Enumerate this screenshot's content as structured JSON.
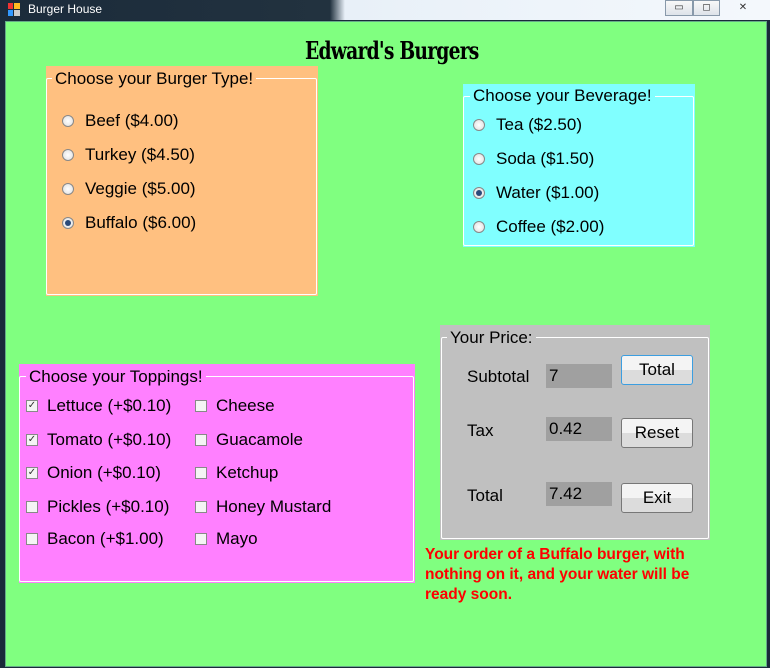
{
  "window": {
    "title": "Burger House",
    "minimize": "▭",
    "restore": "◻",
    "close": "✕"
  },
  "heading": "Edward's Burgers",
  "burger": {
    "legend": "Choose your Burger Type!",
    "options": [
      "Beef ($4.00)",
      "Turkey ($4.50)",
      "Veggie ($5.00)",
      "Buffalo ($6.00)"
    ],
    "selected": 3
  },
  "beverage": {
    "legend": "Choose your Beverage!",
    "options": [
      "Tea ($2.50)",
      "Soda ($1.50)",
      "Water ($1.00)",
      "Coffee ($2.00)"
    ],
    "selected": 2
  },
  "toppings": {
    "legend": "Choose your Toppings!",
    "col1": [
      "Lettuce (+$0.10)",
      "Tomato (+$0.10)",
      "Onion (+$0.10)",
      "Pickles (+$0.10)",
      "Bacon (+$1.00)"
    ],
    "col1_checked": [
      true,
      true,
      true,
      false,
      false
    ],
    "col2": [
      "Cheese",
      "Guacamole",
      "Ketchup",
      "Honey Mustard",
      "Mayo"
    ],
    "col2_checked": [
      false,
      false,
      false,
      false,
      false
    ],
    "check_mark": "✓"
  },
  "price": {
    "legend": "Your Price:",
    "subtotal_label": "Subtotal",
    "subtotal": "7",
    "tax_label": "Tax",
    "tax": "0.42",
    "total_label": "Total",
    "total": "7.42",
    "total_button": "Total",
    "reset_button": "Reset",
    "exit_button": "Exit"
  },
  "message": "Your order of a Buffalo burger, with nothing on it, and your water will be ready soon."
}
